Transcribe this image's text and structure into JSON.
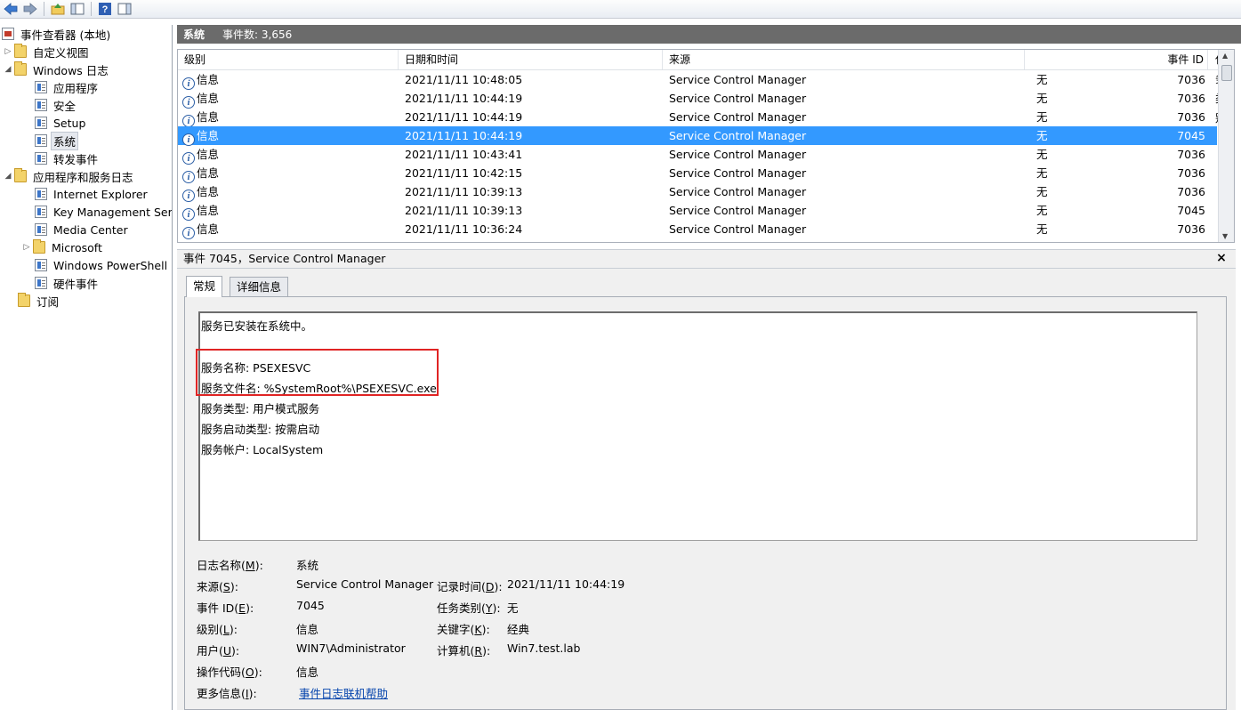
{
  "tree": {
    "root": "事件查看器 (本地)",
    "custom_views": "自定义视图",
    "windows_logs": "Windows 日志",
    "logs": [
      "应用程序",
      "安全",
      "Setup",
      "系统",
      "转发事件"
    ],
    "app_service_logs": "应用程序和服务日志",
    "app_logs": [
      "Internet Explorer",
      "Key Management Serv",
      "Media Center",
      "Microsoft",
      "Windows PowerShell",
      "硬件事件"
    ],
    "subscriptions": "订阅",
    "selected": "系统"
  },
  "pane": {
    "name": "系统",
    "count_label": "事件数: 3,656"
  },
  "list": {
    "columns": [
      "级别",
      "日期和时间",
      "来源",
      "事件 ID",
      "任务类别"
    ],
    "rows": [
      {
        "level": "信息",
        "datetime": "2021/11/11 10:48:05",
        "source": "Service Control Manager",
        "id": "7036",
        "category": "无"
      },
      {
        "level": "信息",
        "datetime": "2021/11/11 10:44:19",
        "source": "Service Control Manager",
        "id": "7036",
        "category": "无"
      },
      {
        "level": "信息",
        "datetime": "2021/11/11 10:44:19",
        "source": "Service Control Manager",
        "id": "7036",
        "category": "无"
      },
      {
        "level": "信息",
        "datetime": "2021/11/11 10:44:19",
        "source": "Service Control Manager",
        "id": "7045",
        "category": "无"
      },
      {
        "level": "信息",
        "datetime": "2021/11/11 10:43:41",
        "source": "Service Control Manager",
        "id": "7036",
        "category": "无"
      },
      {
        "level": "信息",
        "datetime": "2021/11/11 10:42:15",
        "source": "Service Control Manager",
        "id": "7036",
        "category": "无"
      },
      {
        "level": "信息",
        "datetime": "2021/11/11 10:39:13",
        "source": "Service Control Manager",
        "id": "7036",
        "category": "无"
      },
      {
        "level": "信息",
        "datetime": "2021/11/11 10:39:13",
        "source": "Service Control Manager",
        "id": "7045",
        "category": "无"
      },
      {
        "level": "信息",
        "datetime": "2021/11/11 10:36:24",
        "source": "Service Control Manager",
        "id": "7036",
        "category": "无"
      }
    ],
    "selected_index": 3
  },
  "detail": {
    "title": "事件 7045，Service Control Manager",
    "close": "×",
    "tabs": [
      "常规",
      "详细信息"
    ],
    "message": [
      "服务已安装在系统中。",
      "服务名称: PSEXESVC",
      "服务文件名: %SystemRoot%\\PSEXESVC.exe",
      "服务类型: 用户模式服务",
      "服务启动类型: 按需启动",
      "服务帐户: LocalSystem"
    ],
    "props": {
      "log_name_label": "日志名称(",
      "log_name_key": "M",
      "log_name_value": "系统",
      "source_label": "来源(",
      "source_key": "S",
      "source_value": "Service Control Manager",
      "logged_label": "记录时间(",
      "logged_key": "D",
      "logged_value": "2021/11/11 10:44:19",
      "event_id_label": "事件 ID(",
      "event_id_key": "E",
      "event_id_value": "7045",
      "task_label": "任务类别(",
      "task_key": "Y",
      "task_value": "无",
      "level_label": "级别(",
      "level_key": "L",
      "level_value": "信息",
      "keywords_label": "关键字(",
      "keywords_key": "K",
      "keywords_value": "经典",
      "user_label": "用户(",
      "user_key": "U",
      "user_value": "WIN7\\Administrator",
      "computer_label": "计算机(",
      "computer_key": "R",
      "computer_value": "Win7.test.lab",
      "opcode_label": "操作代码(",
      "opcode_key": "O",
      "opcode_value": "信息",
      "more_label": "更多信息(",
      "more_key": "I",
      "more_value": "事件日志联机帮助",
      "suffix": "):"
    }
  },
  "colors": {
    "selection": "#3399ff",
    "header": "#6b6b6b",
    "highlight_box": "#e02424",
    "link": "#0645ad"
  }
}
